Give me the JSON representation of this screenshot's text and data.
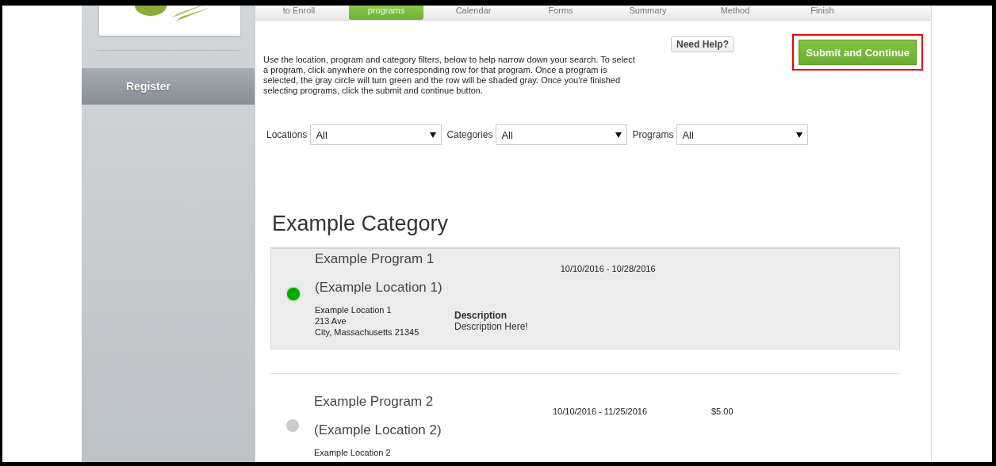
{
  "sidebar": {
    "items": [
      {
        "label": "Register",
        "selected": true
      }
    ]
  },
  "steps": [
    {
      "label": "to Enroll",
      "selected": false
    },
    {
      "label": "programs",
      "selected": true
    },
    {
      "label": "Calendar",
      "selected": false
    },
    {
      "label": "Forms",
      "selected": false
    },
    {
      "label": "Summary",
      "selected": false
    },
    {
      "label": "Method",
      "selected": false
    },
    {
      "label": "Finish",
      "selected": false
    }
  ],
  "instructions": "Use the location, program and category filters, below to help narrow down your search. To select a program, click anywhere on the corresponding row for that program. Once a program is selected, the gray circle will turn green and the row will be shaded gray. Once you're finished selecting programs, click the submit and continue button.",
  "help_button": "Need Help?",
  "submit_button": "Submit and Continue",
  "filters": [
    {
      "label": "Locations",
      "value": "All"
    },
    {
      "label": "Categories",
      "value": "All"
    },
    {
      "label": "Programs",
      "value": "All"
    }
  ],
  "category": "Example Category",
  "programs": [
    {
      "name": "Example Program 1",
      "location": "(Example Location 1)",
      "dates": "10/10/2016 - 10/28/2016",
      "address": [
        "Example Location 1",
        "213 Ave",
        "City, Massachusetts 21345"
      ],
      "description_label": "Description",
      "description": "Description Here!",
      "selected": true
    },
    {
      "name": "Example Program 2",
      "location": "(Example Location 2)",
      "dates": "10/10/2016 - 11/25/2016",
      "price": "$5.00",
      "address": [
        "Example Location 2"
      ],
      "selected": false
    }
  ]
}
